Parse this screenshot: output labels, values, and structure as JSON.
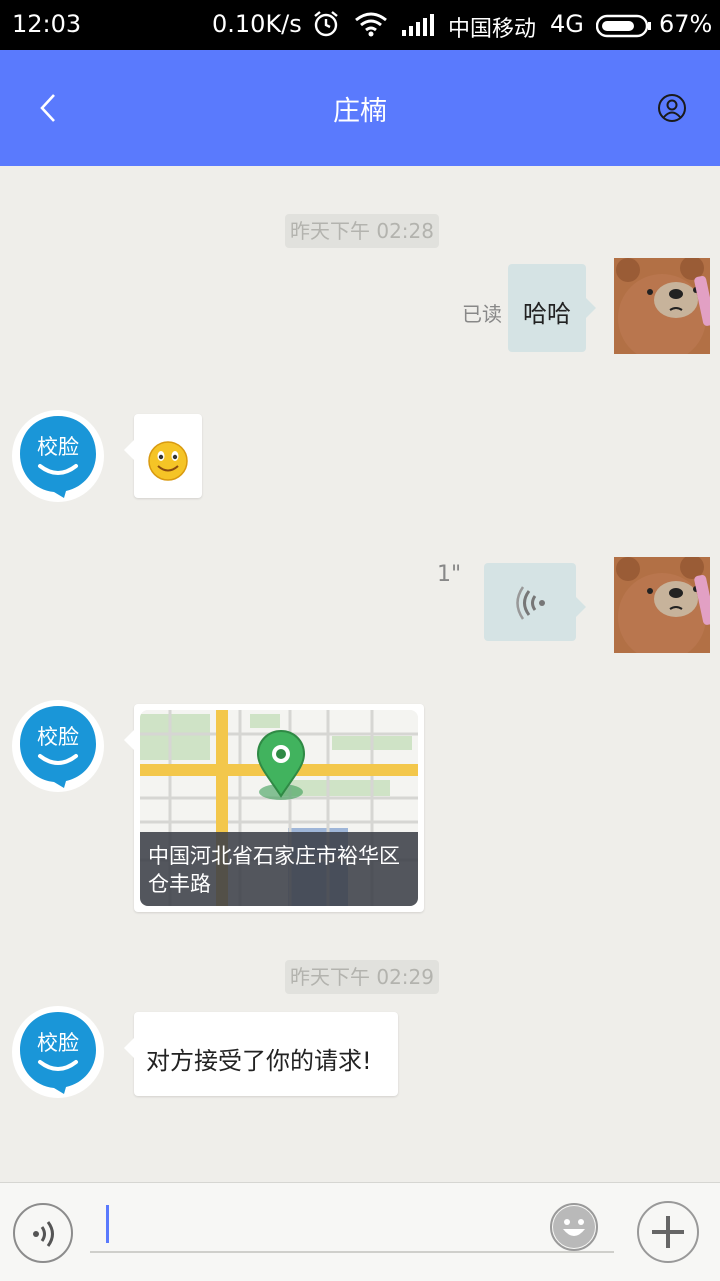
{
  "status_bar": {
    "time": "12:03",
    "speed": "0.10K/s",
    "carrier": "中国移动",
    "network": "4G",
    "battery": "67%"
  },
  "header": {
    "title": "庄楠",
    "back_icon": "chevron-left-icon",
    "profile_icon": "person-icon",
    "color": "#5a7afd"
  },
  "messages": [
    {
      "type": "timestamp",
      "text": "昨天下午 02:28"
    },
    {
      "type": "text",
      "side": "right",
      "text": "哈哈",
      "status": "已读"
    },
    {
      "type": "emoji",
      "side": "left",
      "icon": "smiley-emoji-icon"
    },
    {
      "type": "voice",
      "side": "right",
      "duration": "1\"",
      "icon": "voice-wave-icon"
    },
    {
      "type": "location",
      "side": "left",
      "address": "中国河北省石家庄市裕华区\n仓丰路"
    },
    {
      "type": "timestamp",
      "text": "昨天下午 02:29"
    },
    {
      "type": "text",
      "side": "left",
      "text": "对方接受了你的请求!"
    }
  ],
  "avatar_left": {
    "label": "校脸",
    "color": "#1a96d8"
  },
  "input_bar": {
    "voice_icon": "voice-input-icon",
    "emoji_icon": "emoji-face-icon",
    "plus_icon": "plus-icon",
    "value": ""
  }
}
